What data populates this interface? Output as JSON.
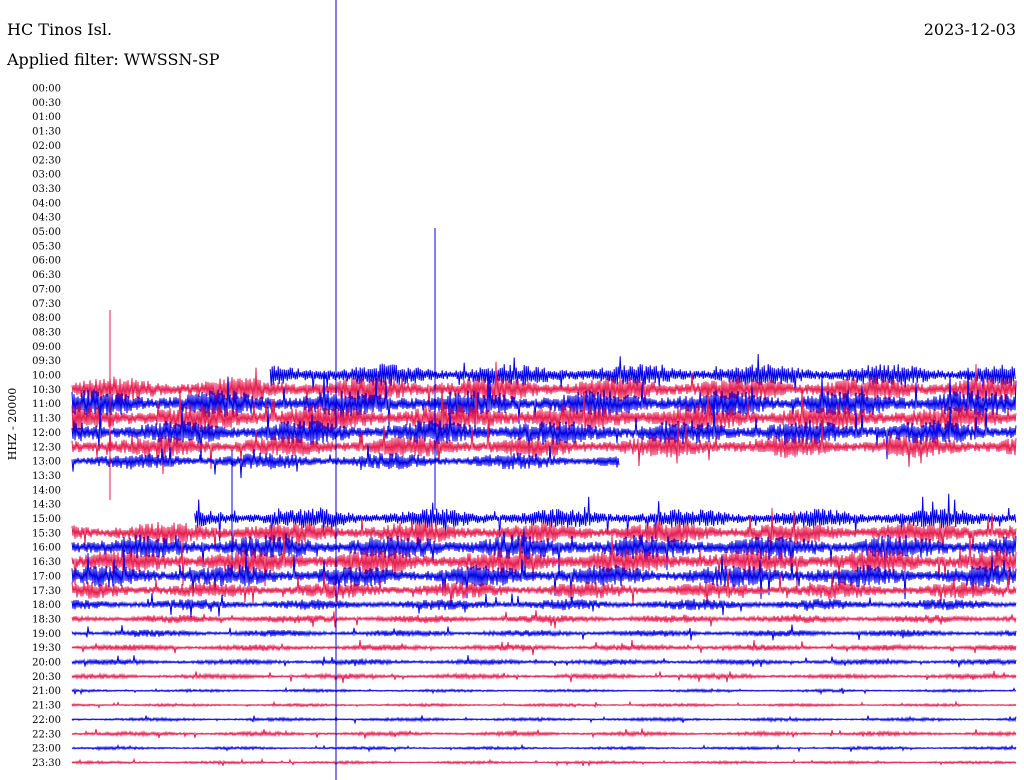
{
  "header": {
    "station": "HC Tinos Isl.",
    "filter": "Applied filter: WWSSN-SP",
    "date": "2023-12-03"
  },
  "chart_data": {
    "type": "line",
    "title": "HC Tinos Isl.",
    "subtitle": "Applied filter: WWSSN-SP",
    "ylabel": "HHZ - 20000",
    "row_labels": [
      "00:00",
      "00:30",
      "01:00",
      "01:30",
      "02:00",
      "02:30",
      "03:00",
      "03:30",
      "04:00",
      "04:30",
      "05:00",
      "05:30",
      "06:00",
      "06:30",
      "07:00",
      "07:30",
      "08:00",
      "08:30",
      "09:00",
      "09:30",
      "10:00",
      "10:30",
      "11:00",
      "11:30",
      "12:00",
      "12:30",
      "13:00",
      "13:30",
      "14:00",
      "14:30",
      "15:00",
      "15:30",
      "16:00",
      "16:30",
      "17:00",
      "17:30",
      "18:00",
      "18:30",
      "19:00",
      "19:30",
      "20:00",
      "20:30",
      "21:00",
      "21:30",
      "22:00",
      "22:30",
      "23:00",
      "23:30"
    ],
    "trace_colors": [
      "#0000e6",
      "#e61e50"
    ],
    "marker_color": "#0000cc",
    "trace_amplitude_level": [
      0,
      0,
      0,
      0,
      0,
      0,
      0,
      0,
      0,
      0,
      0,
      0,
      0,
      0,
      0,
      0,
      0,
      0,
      0,
      0,
      8,
      9,
      10,
      10,
      9,
      8,
      6,
      0,
      0,
      0,
      7,
      8,
      9,
      9,
      8,
      6,
      4,
      3,
      2.5,
      2.2,
      2,
      1.8,
      1,
      1,
      1.2,
      1.5,
      1,
      1
    ],
    "trace_start_fraction": [
      0,
      0,
      0,
      0,
      0,
      0,
      0,
      0,
      0,
      0,
      0,
      0,
      0,
      0,
      0,
      0,
      0,
      0,
      0,
      0,
      0.21,
      0,
      0,
      0,
      0,
      0,
      0,
      0,
      0,
      0,
      0.13,
      0,
      0,
      0,
      0,
      0,
      0,
      0,
      0,
      0,
      0,
      0,
      0,
      0,
      0,
      0,
      0,
      0
    ],
    "trace_end_fraction": [
      1,
      1,
      1,
      1,
      1,
      1,
      1,
      1,
      1,
      1,
      1,
      1,
      1,
      1,
      1,
      1,
      1,
      1,
      1,
      1,
      1,
      1,
      1,
      1,
      1,
      1,
      0.58,
      1,
      1,
      1,
      1,
      1,
      1,
      1,
      1,
      1,
      1,
      1,
      1,
      1,
      1,
      1,
      1,
      1,
      1,
      1,
      1,
      1
    ],
    "grid": false
  }
}
